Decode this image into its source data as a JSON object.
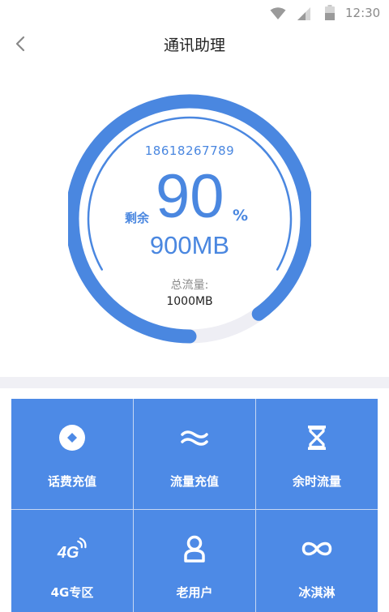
{
  "status_bar": {
    "time": "12:30"
  },
  "header": {
    "title": "通讯助理"
  },
  "gauge": {
    "phone": "18618267789",
    "remain_label": "剩余",
    "percent_value": "90",
    "percent_sign": "%",
    "remaining_mb": "900MB",
    "total_label": "总流量:",
    "total_value": "1000MB",
    "progress_fraction": 0.9
  },
  "colors": {
    "accent": "#4a87e0",
    "track": "#eeeef4",
    "tile": "#4d8ae6"
  },
  "grid": {
    "items": [
      {
        "label": "话费充值",
        "icon": "coin-icon"
      },
      {
        "label": "流量充值",
        "icon": "wave-icon"
      },
      {
        "label": "余时流量",
        "icon": "hourglass-icon"
      },
      {
        "label": "4G专区",
        "icon": "4g-icon"
      },
      {
        "label": "老用户",
        "icon": "user-icon"
      },
      {
        "label": "冰淇淋",
        "icon": "infinity-icon"
      }
    ]
  }
}
